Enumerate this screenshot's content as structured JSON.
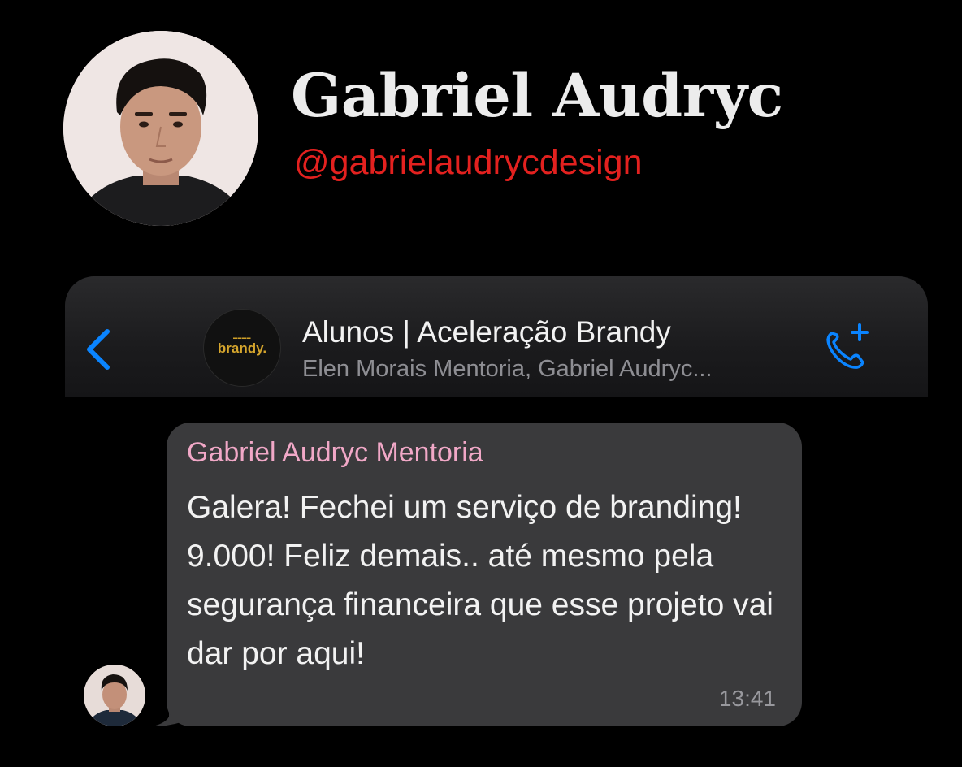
{
  "profile": {
    "name": "Gabriel Audryc",
    "handle": "@gabrielaudrycdesign",
    "avatar_icon": "person-photo"
  },
  "chat": {
    "title": "Alunos | Aceleração Brandy",
    "members": "Elen Morais Mentoria, Gabriel Audryc...",
    "group_avatar_text": "brandy.",
    "back_icon": "chevron-left-icon",
    "call_icon": "phone-plus-icon",
    "accent_color": "#0a84ff"
  },
  "message": {
    "sender": "Gabriel Audryc Mentoria",
    "text": "Galera! Fechei um serviço de branding! 9.000! Feliz demais.. até mesmo pela segurança financeira que esse projeto vai dar por aqui!",
    "time": "13:41",
    "sender_color": "#f1a8c7",
    "bubble_color": "#3a3a3c"
  },
  "colors": {
    "background": "#000000",
    "handle": "#e3211f",
    "name": "#ececec"
  }
}
